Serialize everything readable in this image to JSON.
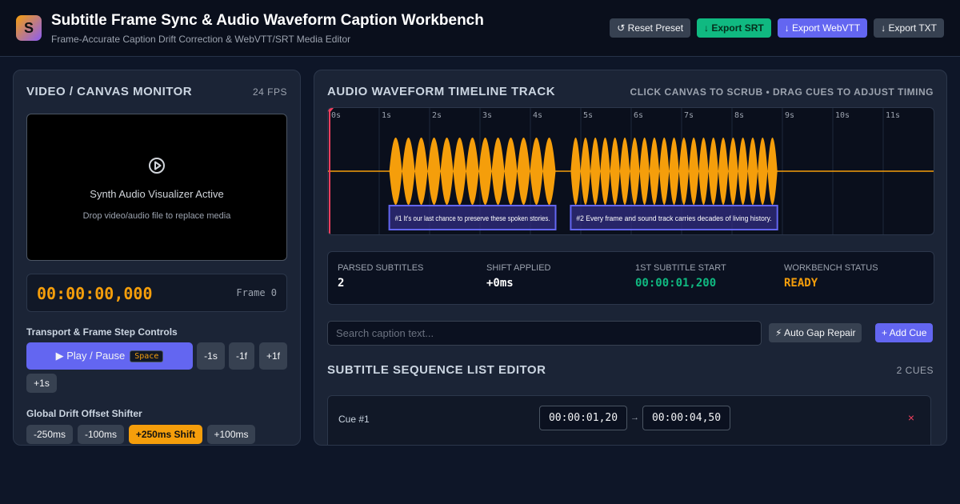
{
  "app": {
    "logo_letter": "S",
    "title": "Subtitle Frame Sync & Audio Waveform Caption Workbench",
    "subtitle": "Frame-Accurate Caption Drift Correction & WebVTT/SRT Media Editor"
  },
  "header_buttons": {
    "reset": "↺ Reset Preset",
    "export_srt": "↓ Export SRT",
    "export_webvtt": "↓ Export WebVTT",
    "export_txt": "↓ Export TXT"
  },
  "monitor": {
    "heading": "VIDEO / CANVAS MONITOR",
    "fps": "24 FPS",
    "title": "Synth Audio Visualizer Active",
    "hint": "Drop video/audio file to replace media",
    "timecode": "00:00:00,000",
    "frame": "Frame 0"
  },
  "transport": {
    "label": "Transport & Frame Step Controls",
    "play_pause": "▶ Play / Pause",
    "shortcut": "Space",
    "back_1s": "-1s",
    "back_1f": "-1f",
    "fwd_1f": "+1f",
    "fwd_1s": "+1s"
  },
  "drift": {
    "label": "Global Drift Offset Shifter",
    "options": [
      "-250ms",
      "-100ms",
      "+250ms Shift",
      "+100ms"
    ],
    "active": "+250ms Shift"
  },
  "timeline": {
    "heading": "AUDIO WAVEFORM TIMELINE TRACK",
    "hint": "CLICK CANVAS TO SCRUB • DRAG CUES TO ADJUST TIMING",
    "ticks": [
      "0s",
      "1s",
      "2s",
      "3s",
      "4s",
      "5s",
      "6s",
      "7s",
      "8s",
      "9s",
      "10s",
      "11s"
    ],
    "duration_s": 12,
    "playhead_s": 0,
    "cues": [
      {
        "start_s": 1.2,
        "end_s": 4.5,
        "text": "#1 It's our last chance to preserve these spoken stories."
      },
      {
        "start_s": 4.8,
        "end_s": 8.9,
        "text": "#2 Every frame and sound track carries decades of living history."
      }
    ],
    "colors": {
      "wave": "#f59e0b",
      "cue_border": "#6366f1",
      "playhead": "#f43f5e"
    }
  },
  "stats": {
    "parsed_label": "PARSED SUBTITLES",
    "parsed_value": "2",
    "shift_label": "SHIFT APPLIED",
    "shift_value": "+0ms",
    "first_label": "1ST SUBTITLE START",
    "first_value": "00:00:01,200",
    "status_label": "WORKBENCH STATUS",
    "status_value": "READY"
  },
  "search": {
    "placeholder": "Search caption text...",
    "value": ""
  },
  "actions": {
    "auto_gap": "⚡ Auto Gap Repair",
    "add_cue": "+ Add Cue"
  },
  "sequence": {
    "heading": "SUBTITLE SEQUENCE LIST EDITOR",
    "count": "2 CUES",
    "rows": [
      {
        "label": "Cue #1",
        "start": "00:00:01,20",
        "arrow": "→",
        "end": "00:00:04,50",
        "delete": "×"
      }
    ]
  }
}
